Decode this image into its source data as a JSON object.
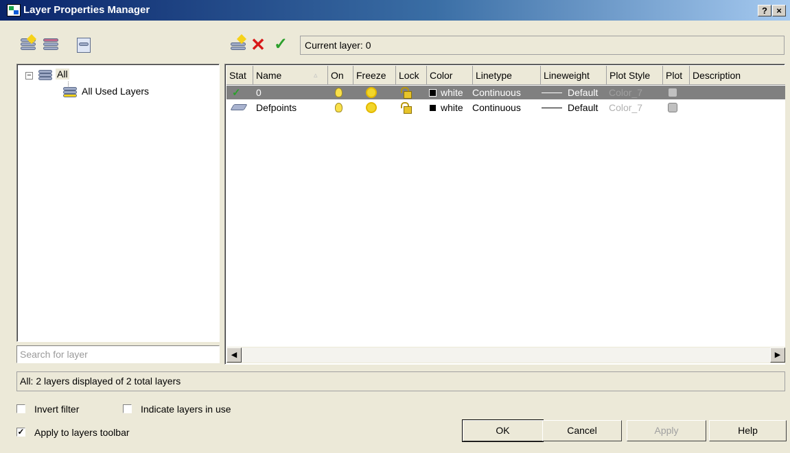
{
  "window": {
    "title": "Layer Properties Manager",
    "help_glyph": "?",
    "close_glyph": "×"
  },
  "current_layer": "Current layer: 0",
  "filter_tree": {
    "root": "All",
    "child": "All Used Layers",
    "collapse_glyph": "−"
  },
  "table": {
    "columns": [
      "Stat",
      "Name",
      "On",
      "Freeze",
      "Lock",
      "Color",
      "Linetype",
      "Lineweight",
      "Plot Style",
      "Plot",
      "Description"
    ],
    "sort_glyph": "▵",
    "rows": [
      {
        "status": "✓",
        "name": "0",
        "color": "white",
        "linetype": "Continuous",
        "lineweight": "Default",
        "plot_style": "Color_7",
        "description": ""
      },
      {
        "status": "",
        "name": "Defpoints",
        "color": "white",
        "linetype": "Continuous",
        "lineweight": "Default",
        "plot_style": "Color_7",
        "description": ""
      }
    ],
    "scroll_left_glyph": "◀",
    "scroll_right_glyph": "▶"
  },
  "search": {
    "placeholder": "Search for layer",
    "value": ""
  },
  "status_text": "All: 2 layers displayed of 2 total layers",
  "options": {
    "invert_filter": {
      "label": "Invert filter",
      "checked": false
    },
    "indicate_in_use": {
      "label": "Indicate layers in use",
      "checked": false
    },
    "apply_toolbar": {
      "label": "Apply to layers toolbar",
      "checked": true,
      "glyph": "✓"
    }
  },
  "buttons": {
    "ok": "OK",
    "cancel": "Cancel",
    "apply": "Apply",
    "help": "Help"
  },
  "toolbar": {
    "delete_glyph": "✕",
    "set_current_glyph": "✓"
  }
}
